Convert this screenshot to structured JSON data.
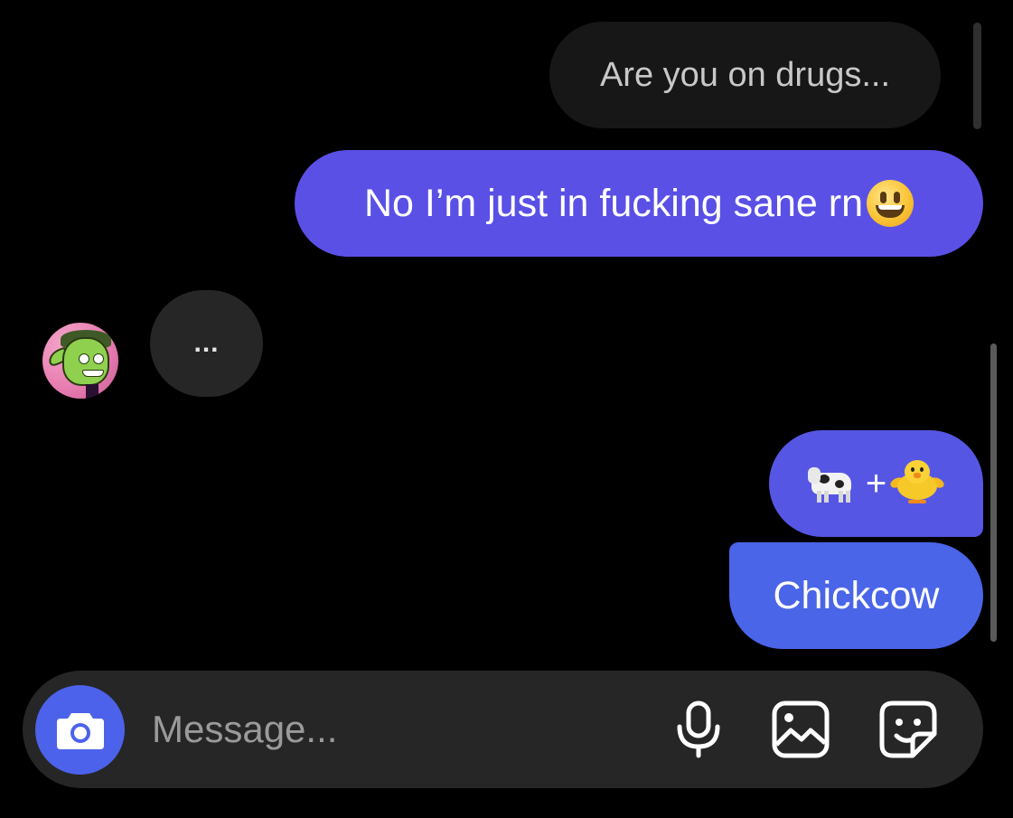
{
  "messages": [
    {
      "id": "received-quote",
      "text": "Are you on drugs..."
    },
    {
      "id": "sent-1",
      "text": "No I’m just in fucking sane rn"
    },
    {
      "id": "typing",
      "text": "..."
    },
    {
      "id": "sent-emoji",
      "text": "+"
    },
    {
      "id": "sent-last",
      "text": "Chickcow"
    }
  ],
  "emoji": {
    "smiley": "grinning-face-emoji",
    "cow": "cow-emoji",
    "chick": "chick-emoji"
  },
  "composer": {
    "placeholder": "Message...",
    "value": "",
    "icons": [
      "camera-icon",
      "microphone-icon",
      "gallery-icon",
      "sticker-icon"
    ]
  },
  "colors": {
    "background": "#000000",
    "received_bubble": "#171717",
    "sent_bubble": "#5a50e6",
    "sent_bubble_last": "#4a65e8",
    "typing_bubble": "#262626",
    "composer": "#262626",
    "camera_button": "#4c62ea"
  }
}
